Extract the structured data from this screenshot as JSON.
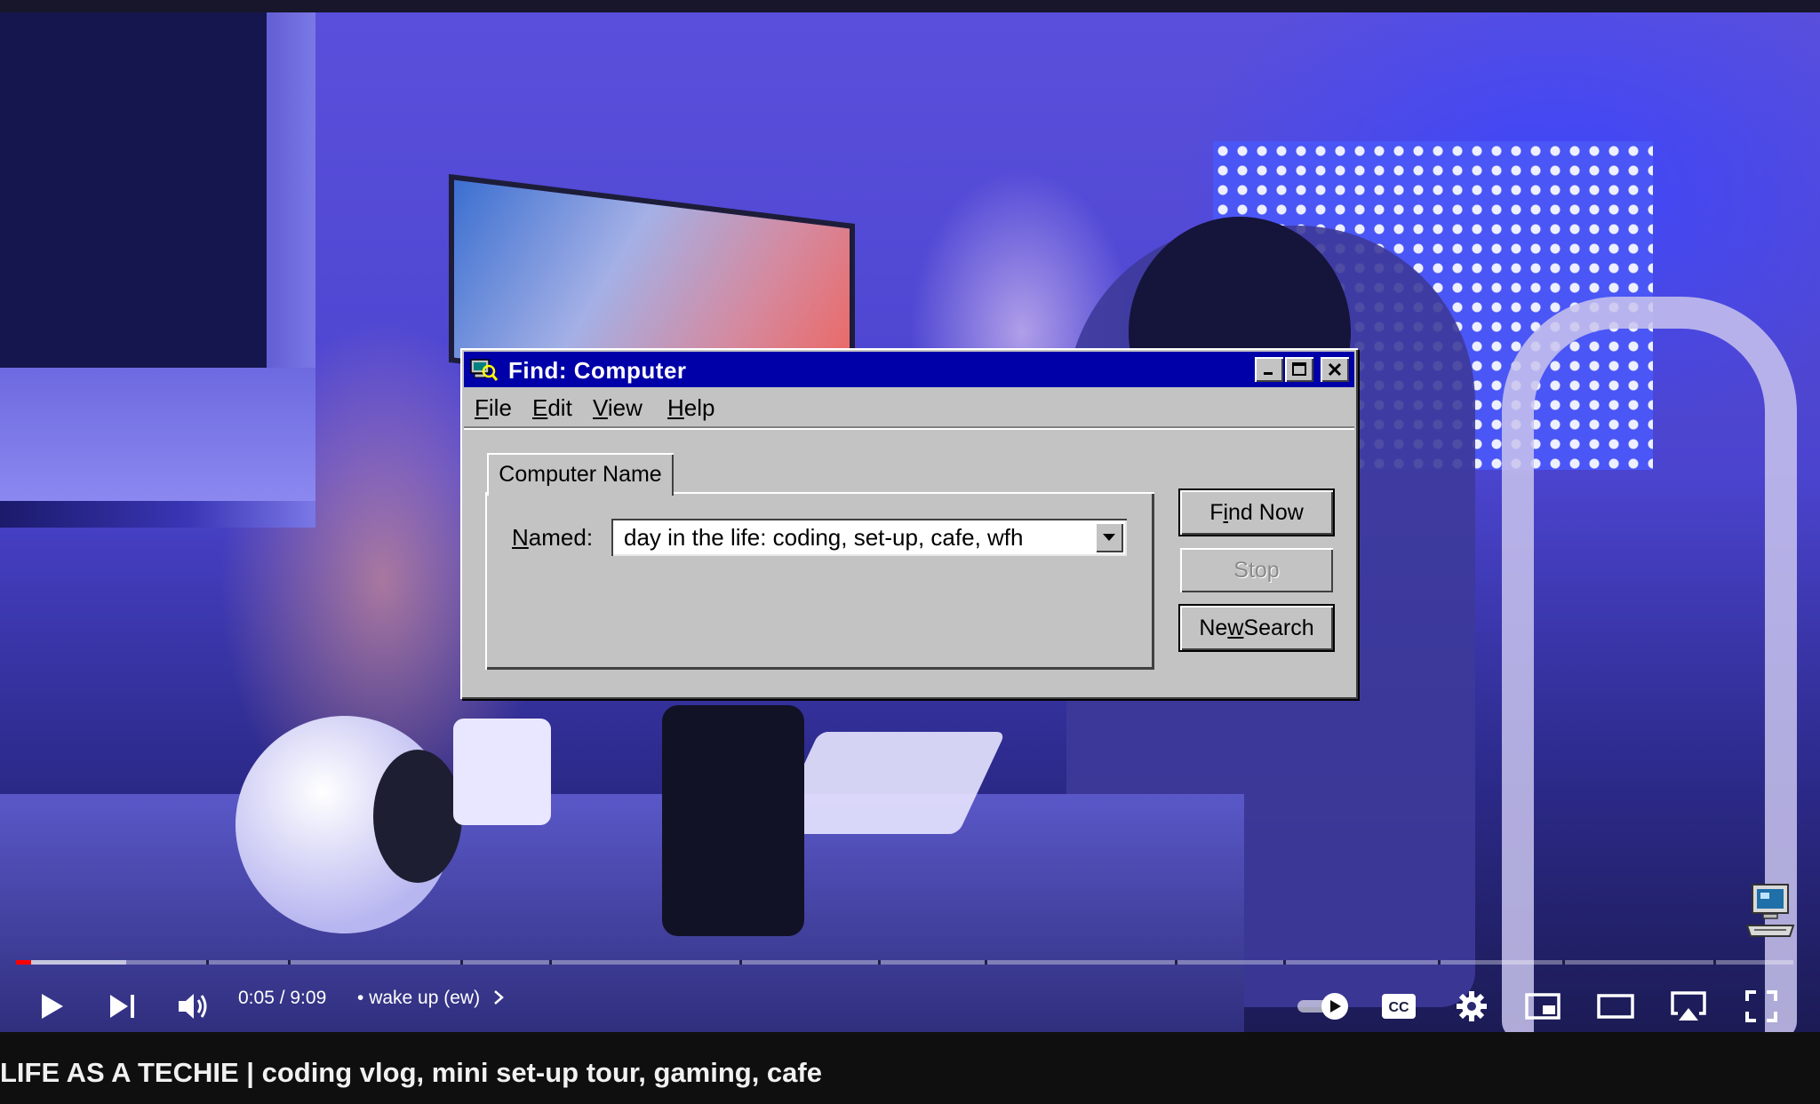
{
  "dialog": {
    "title": "Find: Computer",
    "menu": [
      {
        "label_rest": "ile",
        "mnemonic": "F"
      },
      {
        "label_rest": "dit",
        "mnemonic": "E"
      },
      {
        "label_rest": "iew",
        "mnemonic": "V"
      },
      {
        "label_rest": "elp",
        "mnemonic": "H"
      }
    ],
    "tab_label": "Computer Name",
    "named": {
      "mnemonic": "N",
      "rest": "amed:"
    },
    "named_value": "day in the life: coding, set-up, cafe, wfh",
    "find_now": {
      "pre": "F",
      "mnemonic": "i",
      "post": "nd Now"
    },
    "stop_label": "Stop",
    "new_search": {
      "pre": "Ne",
      "mnemonic": "w",
      "post": " Search"
    }
  },
  "player": {
    "time_display": "0:05 / 9:09",
    "chapter_label": "wake up (ew)",
    "progress_played": 0.0085,
    "progress_buffered": 0.062,
    "chapter_marks": [
      0.107,
      0.153,
      0.25,
      0.3,
      0.407,
      0.485,
      0.545,
      0.652,
      0.713,
      0.8,
      0.87,
      0.955
    ],
    "autoplay_on": true
  },
  "video_title": "LIFE AS A TECHIE | coding vlog, mini set-up tour, gaming, cafe",
  "colors": {
    "titlebar": "#0000a8",
    "dialog_face": "#c3c3c3",
    "progress_red": "#ff0000"
  }
}
